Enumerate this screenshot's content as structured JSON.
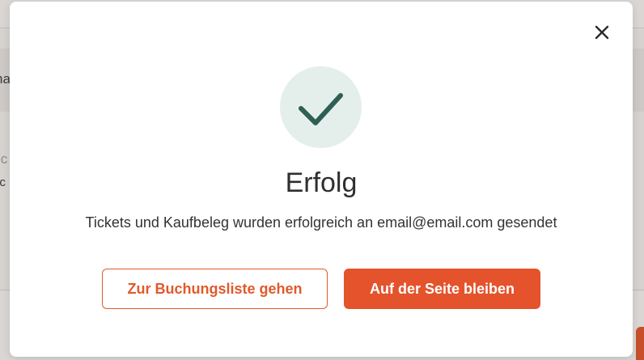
{
  "background": {
    "text_fragments": [
      "na",
      ".c",
      "ic"
    ]
  },
  "dialog": {
    "close_icon": "close-icon",
    "status_icon": "checkmark-icon",
    "title": "Erfolg",
    "message": "Tickets und Kaufbeleg wurden erfolgreich an email@email.com gesendet",
    "secondary_button_label": "Zur Buchungsliste gehen",
    "primary_button_label": "Auf der Seite bleiben"
  },
  "colors": {
    "accent": "#e4532b",
    "success_circle": "#e4efec",
    "checkmark": "#2f5e54"
  }
}
